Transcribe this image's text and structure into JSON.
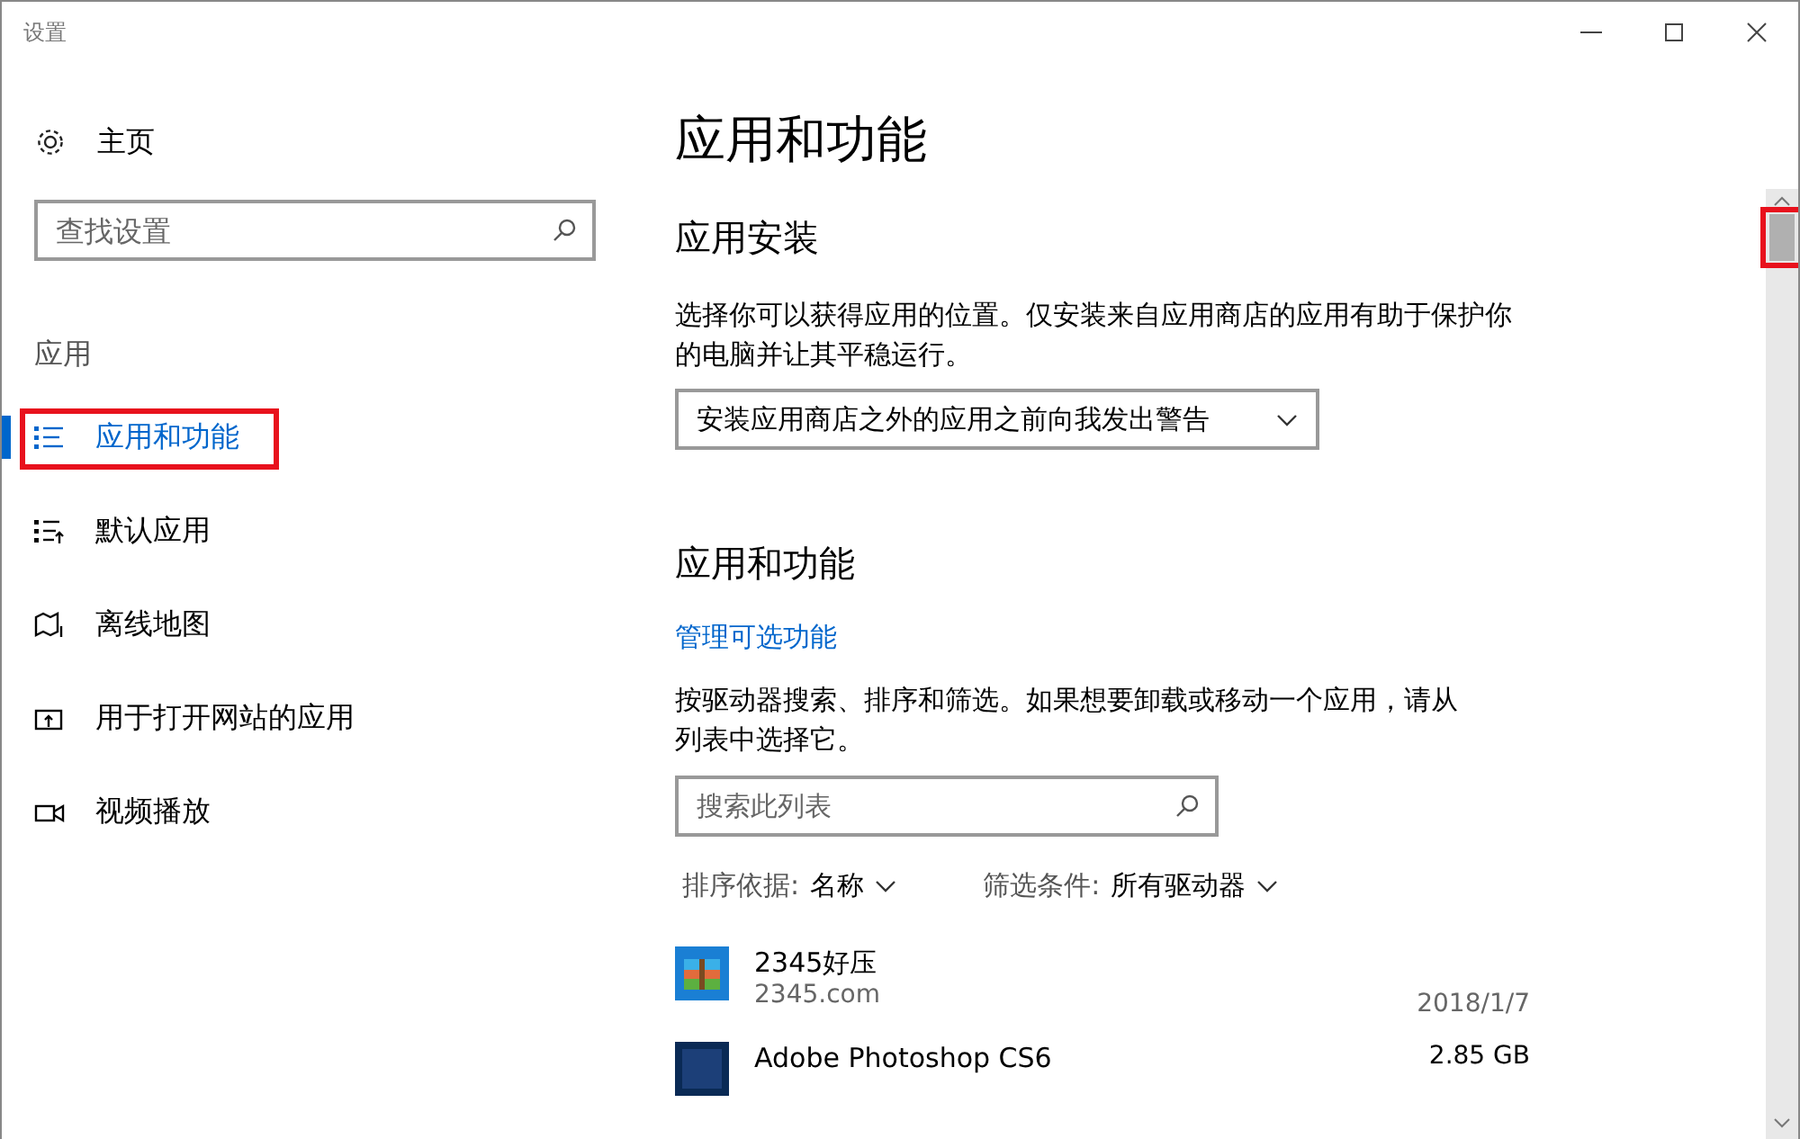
{
  "window": {
    "title": "设置",
    "controls": [
      {
        "kind": "minimize"
      },
      {
        "kind": "maximize"
      },
      {
        "kind": "close"
      }
    ]
  },
  "sidebar": {
    "home": "主页",
    "search": {
      "placeholder": "查找设置"
    },
    "section": "应用",
    "items": [
      {
        "label": "应用和功能",
        "kind": "list",
        "selected": true,
        "highlighted": true
      },
      {
        "label": "默认应用",
        "kind": "default",
        "selected": false,
        "highlighted": false
      },
      {
        "label": "离线地图",
        "kind": "map",
        "selected": false,
        "highlighted": false
      },
      {
        "label": "用于打开网站的应用",
        "kind": "web",
        "selected": false,
        "highlighted": false
      },
      {
        "label": "视频播放",
        "kind": "video",
        "selected": false,
        "highlighted": false
      }
    ]
  },
  "content": {
    "title": "应用和功能",
    "install": {
      "heading": "应用安装",
      "description": "选择你可以获得应用的位置。仅安装来自应用商店的应用有助于保护你的电脑并让其平稳运行。",
      "dropdown": "安装应用商店之外的应用之前向我发出警告"
    },
    "apps": {
      "heading": "应用和功能",
      "link": "管理可选功能",
      "description": "按驱动器搜索、排序和筛选。如果想要卸载或移动一个应用，请从列表中选择它。",
      "search": {
        "placeholder": "搜索此列表"
      },
      "sort": {
        "label": "排序依据:",
        "value": "名称"
      },
      "filter": {
        "label": "筛选条件:",
        "value": "所有驱动器"
      },
      "list": [
        {
          "name": "2345好压",
          "publisher": "2345.com",
          "info": "2018/1/7",
          "kind": "archive"
        },
        {
          "name": "Adobe Photoshop CS6",
          "info": "2.85 GB",
          "kind": "photoshop"
        }
      ]
    }
  },
  "scrollbar": {
    "highlighted": true
  }
}
